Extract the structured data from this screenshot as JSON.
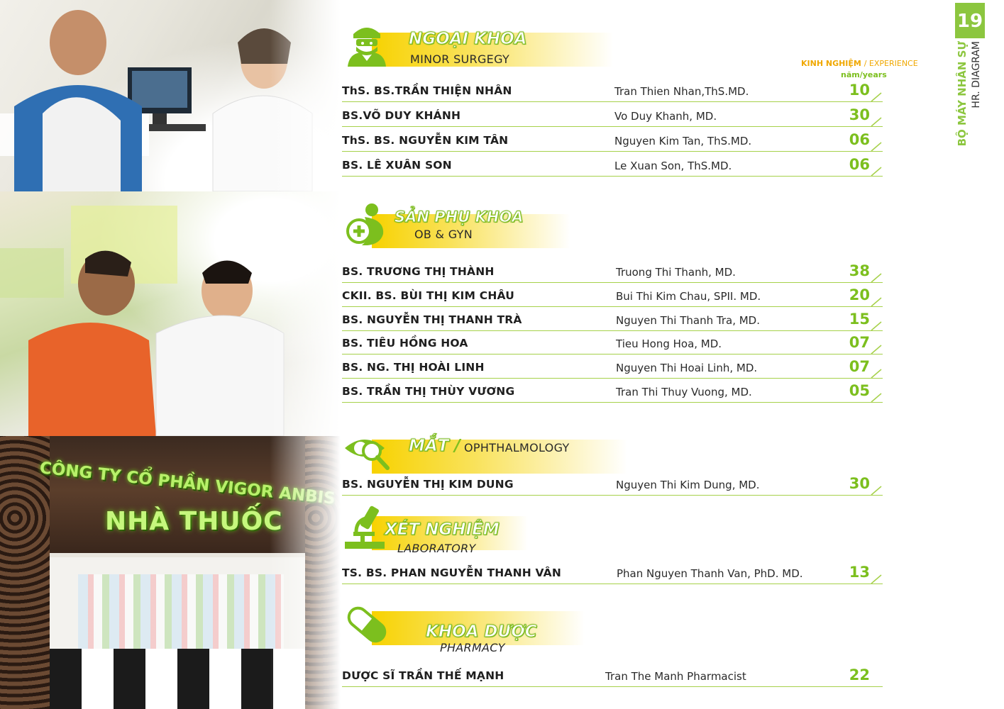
{
  "page": {
    "number": "19",
    "side_title_vn": "BỘ MÁY NHÂN SỰ",
    "side_title_en": "HR. DIAGRAM",
    "experience_label_vn": "KINH NGHIỆM",
    "experience_label_en": "/ EXPERIENCE",
    "years_unit": "năm/years",
    "accent_color": "#8cc63f",
    "band_color": "#f7d200"
  },
  "photos": {
    "pharmacy_sign_line1": "CÔNG TY CỔ PHẦN VIGOR ANBIS JAPAN",
    "pharmacy_sign_line2": "NHÀ THUỐC"
  },
  "sections": [
    {
      "title_vn": "NGOẠI KHOA",
      "title_en": "MINOR SURGEGY",
      "icon": "surgeon-icon",
      "staff": [
        {
          "vn": "ThS. BS.TRẦN THIỆN NHÂN",
          "en": "Tran Thien Nhan,ThS.MD.",
          "years": "10"
        },
        {
          "vn": "BS.VÕ DUY KHÁNH",
          "en": "Vo Duy Khanh, MD.",
          "years": "30"
        },
        {
          "vn": "ThS. BS. NGUYỄN KIM TÂN",
          "en": "Nguyen Kim Tan, ThS.MD.",
          "years": "06"
        },
        {
          "vn": "BS. LÊ XUÂN SON",
          "en": "Le Xuan Son, ThS.MD.",
          "years": "06"
        }
      ]
    },
    {
      "title_vn": "SẢN PHỤ KHOA",
      "title_en": "OB & GYN",
      "icon": "pregnancy-icon",
      "staff": [
        {
          "vn": "BS. TRƯƠNG THỊ THÀNH",
          "en": "Truong Thi Thanh, MD.",
          "years": "38"
        },
        {
          "vn": "CKII. BS. BÙI THỊ KIM CHÂU",
          "en": "Bui Thi Kim Chau, SPII. MD.",
          "years": "20"
        },
        {
          "vn": "BS. NGUYỄN THỊ THANH TRÀ",
          "en": "Nguyen Thi Thanh Tra, MD.",
          "years": "15"
        },
        {
          "vn": "BS. TIÊU HỒNG HOA",
          "en": "Tieu Hong Hoa, MD.",
          "years": "07"
        },
        {
          "vn": "BS. NG. THỊ HOÀI LINH",
          "en": "Nguyen Thi Hoai Linh, MD.",
          "years": "07"
        },
        {
          "vn": "BS. TRẦN THỊ THÙY VƯƠNG",
          "en": "Tran Thi Thuy Vuong, MD.",
          "years": "05"
        }
      ]
    },
    {
      "title_vn": "MẮT",
      "title_en": "OPHTHALMOLOGY",
      "title_sep": "/",
      "icon": "eye-magnifier-icon",
      "staff": [
        {
          "vn": "BS. NGUYỄN THỊ KIM DUNG",
          "en": "Nguyen Thi Kim Dung, MD.",
          "years": "30"
        }
      ]
    },
    {
      "title_vn": "XÉT NGHIỆM",
      "title_en": "LABORATORY",
      "icon": "microscope-icon",
      "staff": [
        {
          "vn": "TS. BS. PHAN NGUYỄN THANH VÂN",
          "en": "Phan Nguyen Thanh Van, PhD. MD.",
          "years": "13"
        }
      ]
    },
    {
      "title_vn": "KHOA DƯỢC",
      "title_en": "PHARMACY",
      "icon": "capsule-icon",
      "staff": [
        {
          "vn": "DƯỢC SĨ TRẦN THẾ MẠNH",
          "en": "Tran The Manh Pharmacist",
          "years": "22"
        }
      ]
    }
  ]
}
